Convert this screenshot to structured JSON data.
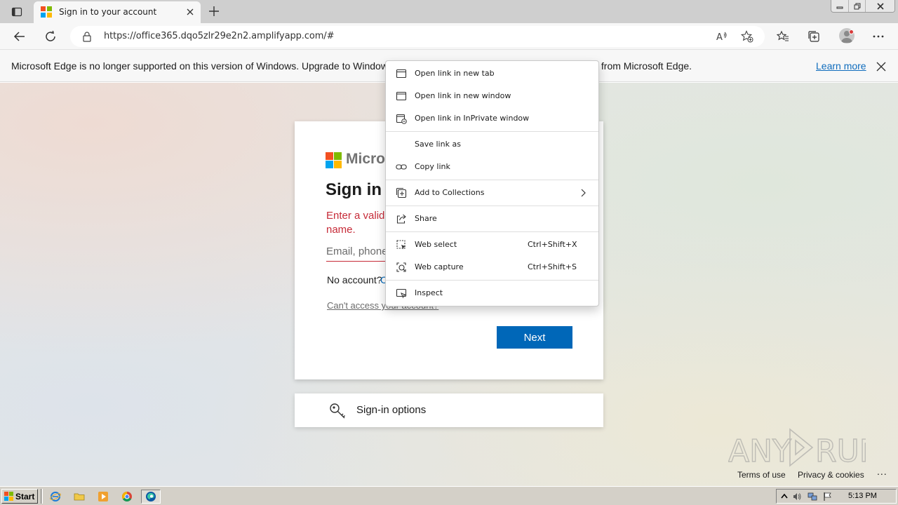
{
  "browser": {
    "tab_title": "Sign in to your account",
    "url": "https://office365.dqo5zlr29e2n2.amplifyapp.com/#"
  },
  "infobar": {
    "message_left": "Microsoft Edge is no longer supported on this version of Windows. Upgrade to Windows 1",
    "message_right": "s from Microsoft Edge.",
    "link": "Learn more"
  },
  "signin": {
    "brand": "Micros",
    "title": "Sign in",
    "error_line1": "Enter a valid",
    "error_line2": "name.",
    "email_placeholder": "Email, phone",
    "no_account": "No account?",
    "create_link": "C",
    "cant_access": "Can't access your account?",
    "next": "Next",
    "options": "Sign-in options"
  },
  "context_menu": {
    "items": [
      {
        "label": "Open link in new tab",
        "icon": "new-tab-icon"
      },
      {
        "label": "Open link in new window",
        "icon": "window-icon"
      },
      {
        "label": "Open link in InPrivate window",
        "icon": "inprivate-icon"
      },
      {
        "label": "Save link as",
        "icon": ""
      },
      {
        "label": "Copy link",
        "icon": "link-icon"
      },
      {
        "label": "Add to Collections",
        "icon": "collections-icon",
        "submenu": true
      },
      {
        "label": "Share",
        "icon": "share-icon"
      },
      {
        "label": "Web select",
        "icon": "web-select-icon",
        "shortcut": "Ctrl+Shift+X"
      },
      {
        "label": "Web capture",
        "icon": "web-capture-icon",
        "shortcut": "Ctrl+Shift+S"
      },
      {
        "label": "Inspect",
        "icon": "inspect-icon"
      }
    ]
  },
  "footer": {
    "terms": "Terms of use",
    "privacy": "Privacy & cookies",
    "more": "..."
  },
  "watermark": {
    "text_left": "ANY",
    "text_right": "RUN"
  },
  "taskbar": {
    "start": "Start",
    "clock": "5:13 PM"
  },
  "colors": {
    "ms_red": "#f25022",
    "ms_green": "#7fba00",
    "ms_blue": "#00a4ef",
    "ms_yellow": "#ffb900",
    "error": "#c62b38",
    "primary": "#0067b8"
  }
}
